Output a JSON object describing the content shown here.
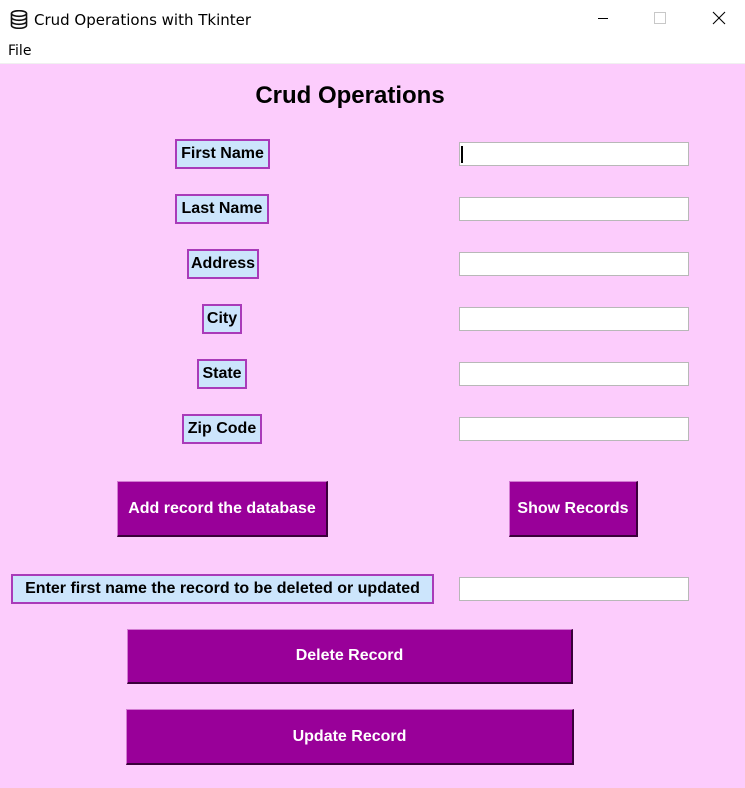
{
  "window": {
    "title": "Crud Operations with Tkinter",
    "icon": "database-icon",
    "minimize_icon": "minimize-icon",
    "maximize_icon": "maximize-icon",
    "close_icon": "close-icon"
  },
  "menu": {
    "file_label": "File"
  },
  "form": {
    "heading": "Crud Operations",
    "first_name_label": "First Name",
    "last_name_label": "Last Name",
    "address_label": "Address",
    "city_label": "City",
    "state_label": "State",
    "zip_code_label": "Zip Code",
    "first_name_value": "",
    "last_name_value": "",
    "address_value": "",
    "city_value": "",
    "state_value": "",
    "zip_code_value": ""
  },
  "actions": {
    "add_label": "Add record the database",
    "show_label": "Show Records",
    "delete_prompt_label": "Enter first name the record to be deleted or updated",
    "delete_prompt_value": "",
    "delete_label": "Delete Record",
    "update_label": "Update Record"
  },
  "colors": {
    "background": "#fcccfc",
    "label_background": "#cce5fc",
    "label_border": "#a93ab9",
    "button_background": "#990099",
    "button_text": "#ffffff"
  }
}
